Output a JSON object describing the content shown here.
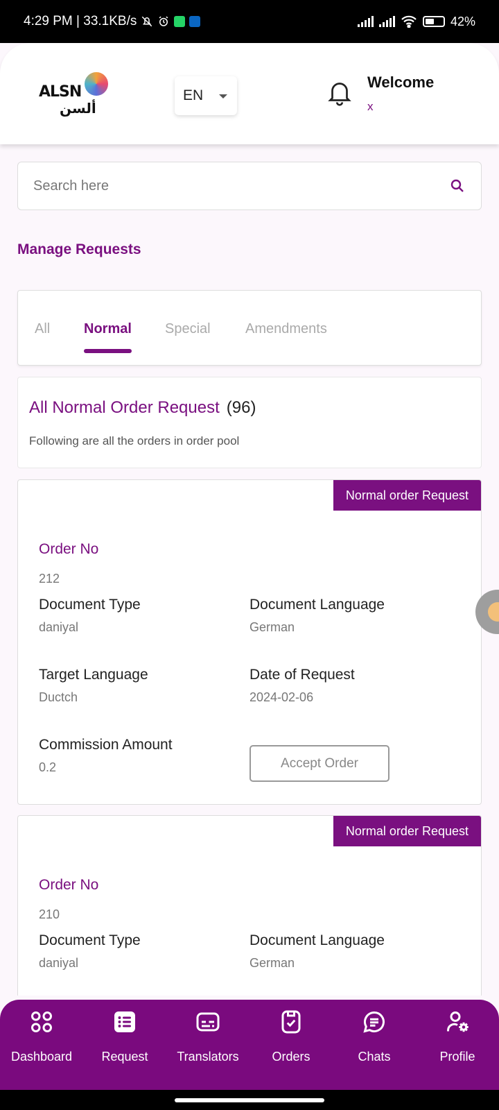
{
  "status_bar": {
    "time_speed": "4:29 PM | 33.1KB/s",
    "battery": "42%"
  },
  "header": {
    "logo_latin": "ALSN",
    "logo_arabic": "ألسن",
    "language": "EN",
    "welcome": "Welcome",
    "user": "x"
  },
  "search": {
    "placeholder": "Search here"
  },
  "page": {
    "title": "Manage Requests"
  },
  "tabs": [
    {
      "label": "All",
      "active": false
    },
    {
      "label": "Normal",
      "active": true
    },
    {
      "label": "Special",
      "active": false
    },
    {
      "label": "Amendments",
      "active": false
    }
  ],
  "summary": {
    "title": "All Normal Order Request",
    "count": "(96)",
    "subtitle": "Following are all the orders in order pool"
  },
  "field_labels": {
    "order_no": "Order No",
    "document_type": "Document Type",
    "document_language": "Document Language",
    "target_language": "Target Language",
    "date_of_request": "Date of Request",
    "commission_amount": "Commission Amount"
  },
  "orders": [
    {
      "tag": "Normal order Request",
      "order_no": "212",
      "document_type": "daniyal",
      "document_language": "German",
      "target_language": "Ductch",
      "date_of_request": "2024-02-06",
      "commission_amount": "0.2",
      "accept_label": "Accept Order"
    },
    {
      "tag": "Normal order Request",
      "order_no": "210",
      "document_type": "daniyal",
      "document_language": "German"
    }
  ],
  "bottom_nav": [
    {
      "label": "Dashboard",
      "icon": "grid-icon"
    },
    {
      "label": "Request",
      "icon": "list-icon"
    },
    {
      "label": "Translators",
      "icon": "subtitles-icon"
    },
    {
      "label": "Orders",
      "icon": "document-check-icon"
    },
    {
      "label": "Chats",
      "icon": "chat-icon"
    },
    {
      "label": "Profile",
      "icon": "user-settings-icon"
    }
  ],
  "colors": {
    "primary": "#7a0a7e",
    "background": "#fcf7fc"
  }
}
